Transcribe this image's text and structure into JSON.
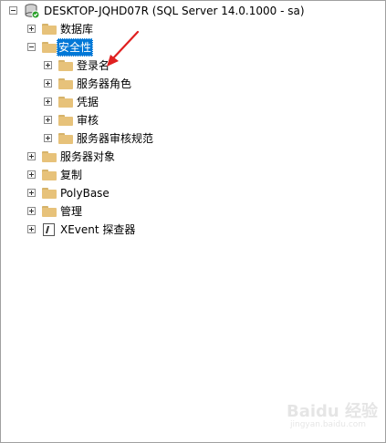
{
  "tree": {
    "root": {
      "label": "DESKTOP-JQHD07R (SQL Server 14.0.1000 - sa)"
    },
    "databases": {
      "label": "数据库"
    },
    "security": {
      "label": "安全性",
      "children": [
        "登录名",
        "服务器角色",
        "凭据",
        "审核",
        "服务器审核规范"
      ]
    },
    "server_objects": {
      "label": "服务器对象"
    },
    "replication": {
      "label": "复制"
    },
    "polybase": {
      "label": "PolyBase"
    },
    "management": {
      "label": "管理"
    },
    "xevent": {
      "label": "XEvent 探查器"
    }
  },
  "watermark": {
    "text": "Baidu 经验",
    "sub": "jingyan.baidu.com"
  },
  "colors": {
    "selection": "#0078d7",
    "arrow": "#e02020",
    "folder": "#e7c27a"
  },
  "icons": {
    "expand": "plus-box-icon",
    "collapse": "minus-box-icon",
    "folder": "folder-icon",
    "server": "server-icon",
    "xevent": "xevent-icon"
  }
}
